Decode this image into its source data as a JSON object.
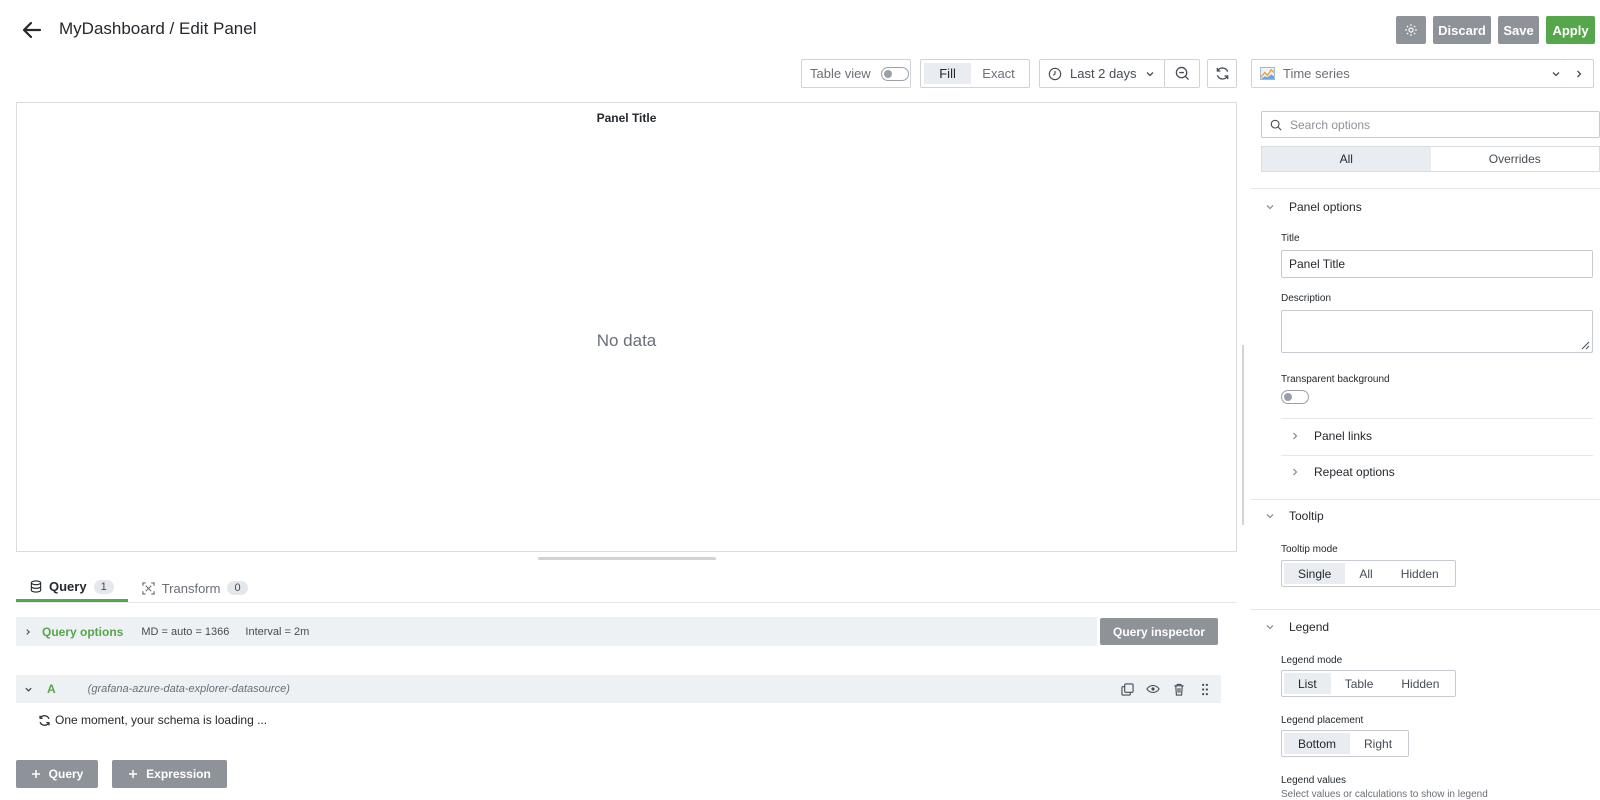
{
  "header": {
    "title": "MyDashboard / Edit Panel",
    "discard_label": "Discard",
    "save_label": "Save",
    "apply_label": "Apply"
  },
  "toolbar": {
    "table_view_label": "Table view",
    "table_view_on": false,
    "fill_label": "Fill",
    "exact_label": "Exact",
    "active_mode": "Fill",
    "time_range": "Last 2 days",
    "visualization": "Time series"
  },
  "panel": {
    "title": "Panel Title",
    "no_data": "No data"
  },
  "tabs": [
    {
      "label": "Query",
      "count": "1"
    },
    {
      "label": "Transform",
      "count": "0"
    }
  ],
  "query_options": {
    "label": "Query options",
    "md": "MD = auto = 1366",
    "interval": "Interval = 2m",
    "inspector_label": "Query inspector"
  },
  "query": {
    "ref_id": "A",
    "datasource": "(grafana-azure-data-explorer-datasource)",
    "loading_text": "One moment, your schema is loading ..."
  },
  "add_buttons": {
    "query": "Query",
    "expression": "Expression"
  },
  "options_pane": {
    "search_placeholder": "Search options",
    "all_label": "All",
    "overrides_label": "Overrides",
    "panel_options": {
      "header": "Panel options",
      "title_label": "Title",
      "title_value": "Panel Title",
      "description_label": "Description",
      "description_value": "",
      "transparent_label": "Transparent background",
      "transparent_on": false,
      "panel_links": "Panel links",
      "repeat_options": "Repeat options"
    },
    "tooltip": {
      "header": "Tooltip",
      "mode_label": "Tooltip mode",
      "options": [
        "Single",
        "All",
        "Hidden"
      ],
      "selected": "Single"
    },
    "legend": {
      "header": "Legend",
      "mode_label": "Legend mode",
      "mode_options": [
        "List",
        "Table",
        "Hidden"
      ],
      "mode_selected": "List",
      "placement_label": "Legend placement",
      "placement_options": [
        "Bottom",
        "Right"
      ],
      "placement_selected": "Bottom",
      "values_label": "Legend values",
      "values_hint": "Select values or calculations to show in legend"
    }
  },
  "colors": {
    "accent_green": "#56a64b",
    "button_gray": "#8e9299"
  }
}
